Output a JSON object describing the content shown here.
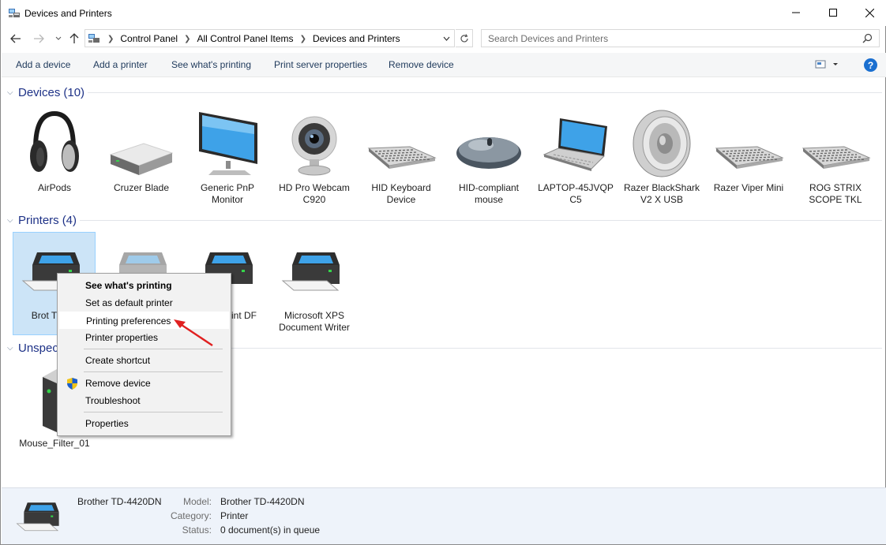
{
  "window": {
    "title": "Devices and Printers",
    "minimize_icon": "minimize",
    "maximize_icon": "maximize",
    "close_icon": "close"
  },
  "address": {
    "breadcrumbs": [
      "Control Panel",
      "All Control Panel Items",
      "Devices and Printers"
    ],
    "search_placeholder": "Search Devices and Printers"
  },
  "toolbar": {
    "add_device": "Add a device",
    "add_printer": "Add a printer",
    "see_printing": "See what's printing",
    "print_server": "Print server properties",
    "remove_device": "Remove device"
  },
  "devices_group": {
    "title": "Devices",
    "count": "(10)",
    "items": [
      {
        "label": "AirPods",
        "icon": "headphones-icon"
      },
      {
        "label": "Cruzer Blade",
        "icon": "usb-drive-icon"
      },
      {
        "label": "Generic PnP Monitor",
        "icon": "monitor-icon"
      },
      {
        "label": "HD Pro Webcam C920",
        "icon": "webcam-icon"
      },
      {
        "label": "HID Keyboard Device",
        "icon": "keyboard-icon"
      },
      {
        "label": "HID-compliant mouse",
        "icon": "mouse-icon"
      },
      {
        "label": "LAPTOP-45JVQP C5",
        "icon": "laptop-icon"
      },
      {
        "label": "Razer BlackShark V2 X USB",
        "icon": "speaker-icon"
      },
      {
        "label": "Razer Viper Mini",
        "icon": "keyboard-icon"
      },
      {
        "label": "ROG STRIX SCOPE TKL",
        "icon": "keyboard-icon"
      }
    ]
  },
  "printers_group": {
    "title": "Printers",
    "count": "(4)",
    "items": [
      {
        "label": "Brot TD-44",
        "icon": "printer-icon"
      },
      {
        "label": "",
        "icon": "printer-icon"
      },
      {
        "label": "ft Print DF",
        "icon": "printer-icon"
      },
      {
        "label": "Microsoft XPS Document Writer",
        "icon": "printer-icon"
      }
    ]
  },
  "unspecified_group": {
    "title": "Unspec",
    "items": [
      {
        "label": "Mouse_Filter_01",
        "icon": "tower-computer-icon"
      }
    ]
  },
  "context_menu": {
    "items": [
      "See what's printing",
      "Set as default printer",
      "Printing preferences",
      "Printer properties",
      "Create shortcut",
      "Remove device",
      "Troubleshoot",
      "Properties"
    ]
  },
  "details": {
    "name": "Brother TD-4420DN",
    "model_key": "Model:",
    "model_val": "Brother TD-4420DN",
    "category_key": "Category:",
    "category_val": "Printer",
    "status_key": "Status:",
    "status_val": "0 document(s) in queue"
  },
  "colors": {
    "accent": "#1e3287",
    "selection": "#cce4f7",
    "help": "#1a6fd0",
    "arrow": "#e02020"
  }
}
